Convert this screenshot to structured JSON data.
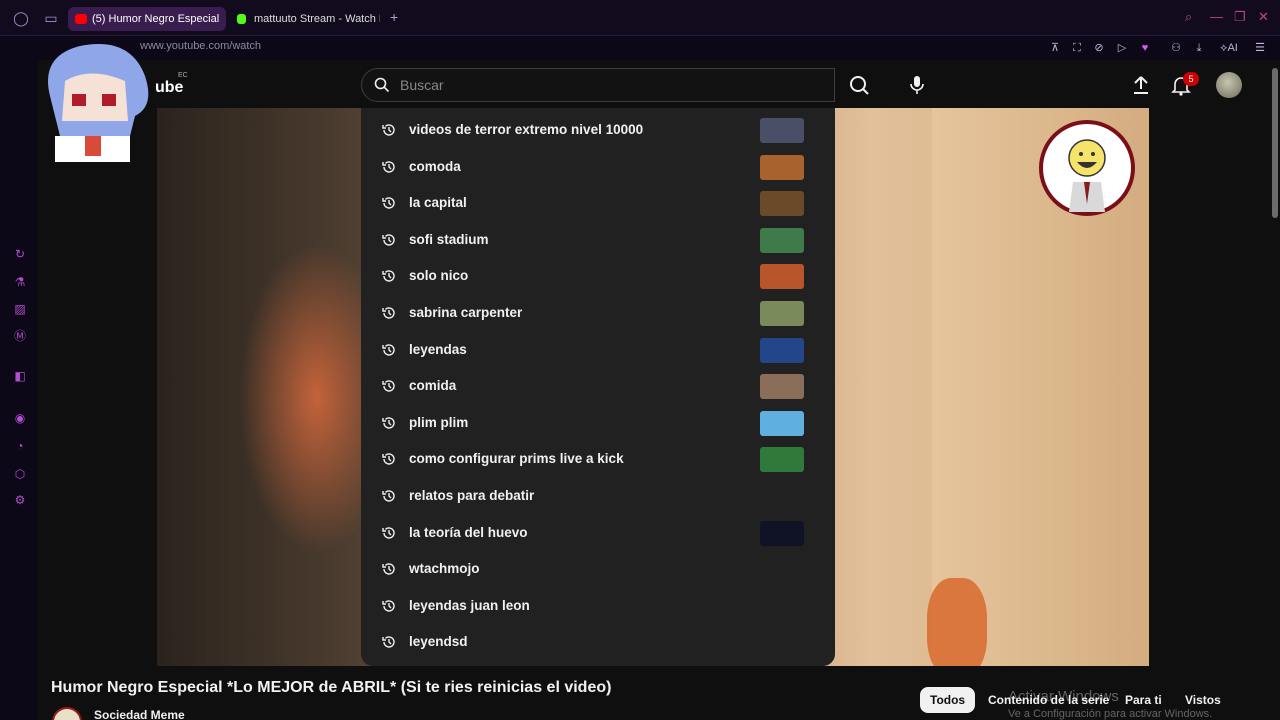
{
  "browser": {
    "tabs": [
      {
        "label": "(5) Humor Negro Especial",
        "active": true,
        "favicon_color": "#ff0000"
      },
      {
        "label": "mattuuto Stream - Watch L",
        "active": false,
        "favicon_color": "#53fc18"
      }
    ],
    "new_tab_icon": "plus-icon",
    "url": "www.youtube.com/watch",
    "ai_label": "AI"
  },
  "sidebar": {
    "icons": [
      "refresh-icon",
      "shopping-icon",
      "gx-icon",
      "messenger-icon",
      "twitch-icon",
      "player-icon",
      "history-icon",
      "extensions-icon",
      "settings-icon"
    ]
  },
  "youtube": {
    "logo_text": "ube",
    "region": "EC",
    "search_placeholder": "Buscar",
    "notification_count": "5",
    "suggestions": [
      {
        "text": "videos de terror extremo nivel 10000",
        "thumb": "#4a4f68"
      },
      {
        "text": "comoda",
        "thumb": "#a8622e"
      },
      {
        "text": "la capital",
        "thumb": "#6b4a2a"
      },
      {
        "text": "sofi stadium",
        "thumb": "#3f7a4a"
      },
      {
        "text": "solo nico",
        "thumb": "#b8552a"
      },
      {
        "text": "sabrina carpenter",
        "thumb": "#7a8a5a"
      },
      {
        "text": "leyendas",
        "thumb": "#23458a"
      },
      {
        "text": "comida",
        "thumb": "#8a6e5a"
      },
      {
        "text": "plim plim",
        "thumb": "#5fb0e0"
      },
      {
        "text": "como configurar prims live a kick",
        "thumb": "#2f7a3a"
      },
      {
        "text": "relatos para debatir",
        "thumb": null
      },
      {
        "text": "la teoría del huevo",
        "thumb": "#101226"
      },
      {
        "text": "wtachmojo",
        "thumb": null
      },
      {
        "text": "leyendas juan leon",
        "thumb": null
      },
      {
        "text": "leyendsd",
        "thumb": null
      }
    ],
    "video_title": "Humor Negro Especial *Lo MEJOR de ABRIL* (Si te ries reinicias el video)",
    "channel_name": "Sociedad Meme",
    "chips": [
      "Todos",
      "Contenido de la serie",
      "Para ti",
      "Vistos"
    ],
    "watermark_title": "Activar Windows",
    "watermark_sub": "Ve a Configuración para activar Windows."
  },
  "colors": {
    "accent": "#c2428a",
    "youtube_bg": "#0f0f0f",
    "dropdown_bg": "#212121"
  }
}
